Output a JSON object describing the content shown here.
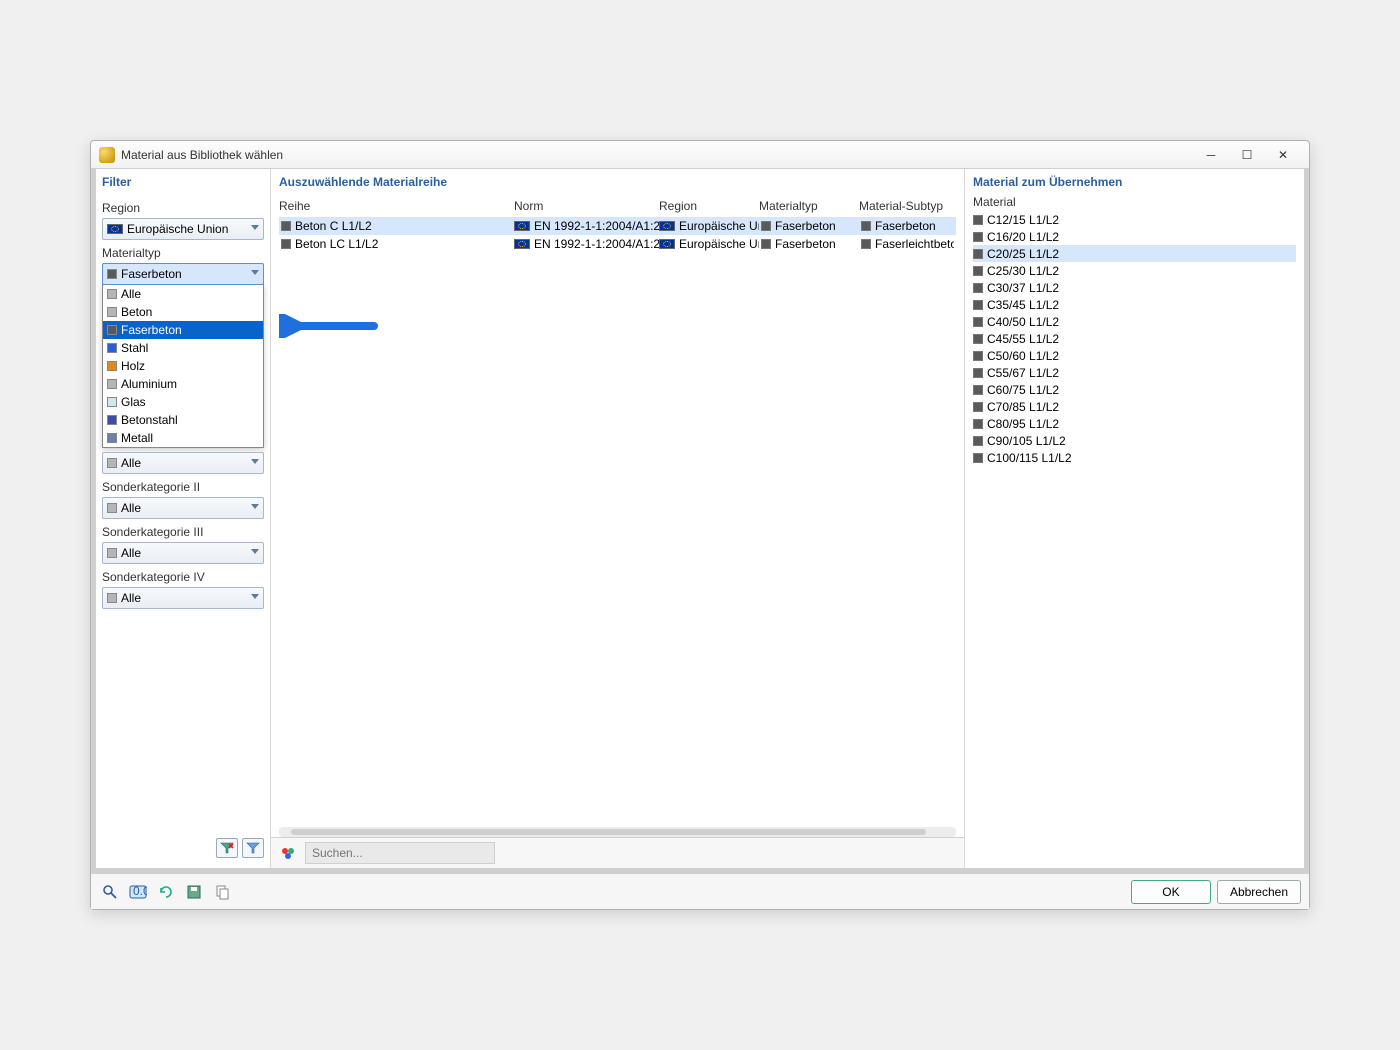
{
  "window": {
    "title": "Material aus Bibliothek wählen"
  },
  "filter": {
    "title": "Filter",
    "region_label": "Region",
    "region_value": "Europäische Union",
    "materialtyp_label": "Materialtyp",
    "materialtyp_value": "Faserbeton",
    "materialtyp_options": [
      {
        "label": "Alle",
        "sw": "sw-gray"
      },
      {
        "label": "Beton",
        "sw": "sw-gray"
      },
      {
        "label": "Faserbeton",
        "sw": "sw-darkgray",
        "selected": true
      },
      {
        "label": "Stahl",
        "sw": "sw-blue"
      },
      {
        "label": "Holz",
        "sw": "sw-orange"
      },
      {
        "label": "Aluminium",
        "sw": "sw-gray"
      },
      {
        "label": "Glas",
        "sw": "sw-ltblue"
      },
      {
        "label": "Betonstahl",
        "sw": "sw-steel"
      },
      {
        "label": "Metall",
        "sw": "sw-bluegray"
      }
    ],
    "alle_label": "Alle",
    "sk2_label": "Sonderkategorie II",
    "sk3_label": "Sonderkategorie III",
    "sk4_label": "Sonderkategorie IV"
  },
  "center": {
    "title": "Auszuwählende Materialreihe",
    "cols": {
      "reihe": "Reihe",
      "norm": "Norm",
      "region": "Region",
      "mtyp": "Materialtyp",
      "msub": "Material-Subtyp"
    },
    "rows": [
      {
        "reihe": "Beton C L1/L2",
        "norm": "EN 1992-1-1:2004/A1:2...",
        "region": "Europäische Uni...",
        "mtyp": "Faserbeton",
        "msub": "Faserbeton",
        "selected": true
      },
      {
        "reihe": "Beton LC L1/L2",
        "norm": "EN 1992-1-1:2004/A1:2...",
        "region": "Europäische Uni...",
        "mtyp": "Faserbeton",
        "msub": "Faserleichtbeton"
      }
    ],
    "search_placeholder": "Suchen..."
  },
  "right": {
    "title": "Material zum Übernehmen",
    "col": "Material",
    "items": [
      {
        "label": "C12/15 L1/L2"
      },
      {
        "label": "C16/20 L1/L2"
      },
      {
        "label": "C20/25 L1/L2",
        "selected": true
      },
      {
        "label": "C25/30 L1/L2"
      },
      {
        "label": "C30/37 L1/L2"
      },
      {
        "label": "C35/45 L1/L2"
      },
      {
        "label": "C40/50 L1/L2"
      },
      {
        "label": "C45/55 L1/L2"
      },
      {
        "label": "C50/60 L1/L2"
      },
      {
        "label": "C55/67 L1/L2"
      },
      {
        "label": "C60/75 L1/L2"
      },
      {
        "label": "C70/85 L1/L2"
      },
      {
        "label": "C80/95 L1/L2"
      },
      {
        "label": "C90/105 L1/L2"
      },
      {
        "label": "C100/115 L1/L2"
      }
    ]
  },
  "buttons": {
    "ok": "OK",
    "cancel": "Abbrechen"
  }
}
